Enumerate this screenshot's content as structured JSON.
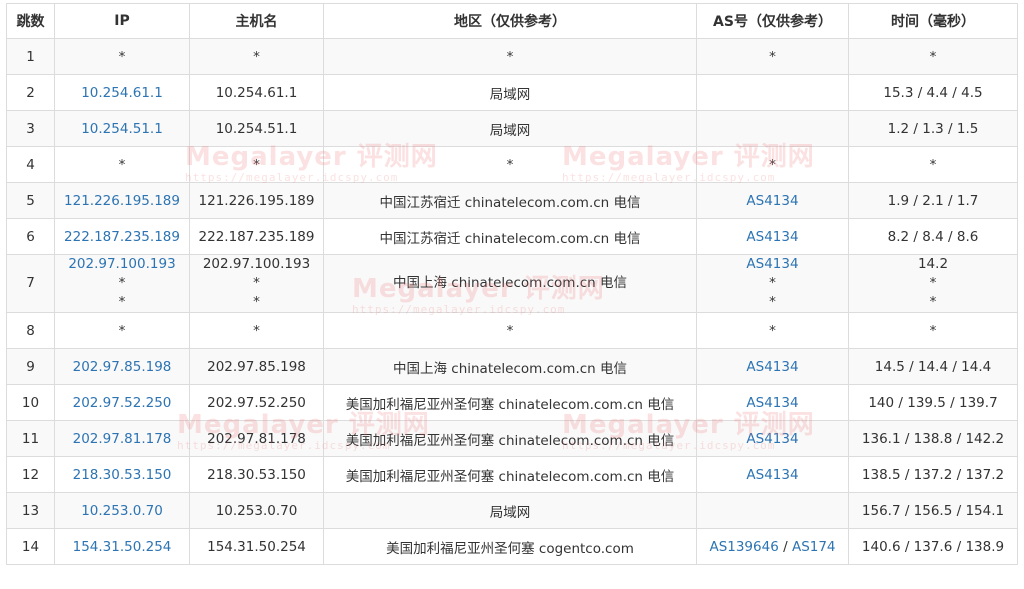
{
  "headers": {
    "hop": "跳数",
    "ip": "IP",
    "host": "主机名",
    "region": "地区（仅供参考）",
    "as": "AS号（仅供参考）",
    "time": "时间（毫秒）"
  },
  "watermark": {
    "title": "Megalayer 评测网",
    "url": "https://megalayer.idcspy.com"
  },
  "rows": [
    {
      "hop": "1",
      "ip": "*",
      "host": "*",
      "region": "*",
      "as": "*",
      "time": "*"
    },
    {
      "hop": "2",
      "ip": "10.254.61.1",
      "host": "10.254.61.1",
      "region": "局域网",
      "as": "",
      "time": "15.3 / 4.4 / 4.5"
    },
    {
      "hop": "3",
      "ip": "10.254.51.1",
      "host": "10.254.51.1",
      "region": "局域网",
      "as": "",
      "time": "1.2 / 1.3 / 1.5"
    },
    {
      "hop": "4",
      "ip": "*",
      "host": "*",
      "region": "*",
      "as": "*",
      "time": "*"
    },
    {
      "hop": "5",
      "ip": "121.226.195.189",
      "host": "121.226.195.189",
      "region": "中国江苏宿迁 chinatelecom.com.cn 电信",
      "as": "AS4134",
      "time": "1.9 / 2.1 / 1.7"
    },
    {
      "hop": "6",
      "ip": "222.187.235.189",
      "host": "222.187.235.189",
      "region": "中国江苏宿迁 chinatelecom.com.cn 电信",
      "as": "AS4134",
      "time": "8.2 / 8.4 / 8.6"
    },
    {
      "hop": "7",
      "ip": "202.97.100.193",
      "host": "202.97.100.193",
      "region": "中国上海 chinatelecom.com.cn 电信",
      "as": "AS4134",
      "time": "14.2"
    },
    {
      "hop": "8",
      "ip": "*",
      "host": "*",
      "region": "*",
      "as": "*",
      "time": "*"
    },
    {
      "hop": "9",
      "ip": "202.97.85.198",
      "host": "202.97.85.198",
      "region": "中国上海 chinatelecom.com.cn 电信",
      "as": "AS4134",
      "time": "14.5 / 14.4 / 14.4"
    },
    {
      "hop": "10",
      "ip": "202.97.52.250",
      "host": "202.97.52.250",
      "region": "美国加利福尼亚州圣何塞 chinatelecom.com.cn 电信",
      "as": "AS4134",
      "time": "140 / 139.5 / 139.7"
    },
    {
      "hop": "11",
      "ip": "202.97.81.178",
      "host": "202.97.81.178",
      "region": "美国加利福尼亚州圣何塞 chinatelecom.com.cn 电信",
      "as": "AS4134",
      "time": "136.1 / 138.8 / 142.2"
    },
    {
      "hop": "12",
      "ip": "218.30.53.150",
      "host": "218.30.53.150",
      "region": "美国加利福尼亚州圣何塞 chinatelecom.com.cn 电信",
      "as": "AS4134",
      "time": "138.5 / 137.2 / 137.2"
    },
    {
      "hop": "13",
      "ip": "10.253.0.70",
      "host": "10.253.0.70",
      "region": "局域网",
      "as": "",
      "time": "156.7 / 156.5 / 154.1"
    },
    {
      "hop": "14",
      "ip": "154.31.50.254",
      "host": "154.31.50.254",
      "region": "美国加利福尼亚州圣何塞 cogentco.com",
      "as": "AS139646",
      "as2": "AS174",
      "as_sep": "/",
      "time": "140.6 / 137.6 / 138.9"
    }
  ],
  "multi_line_extra": {
    "line2": "*",
    "line3": "*"
  }
}
